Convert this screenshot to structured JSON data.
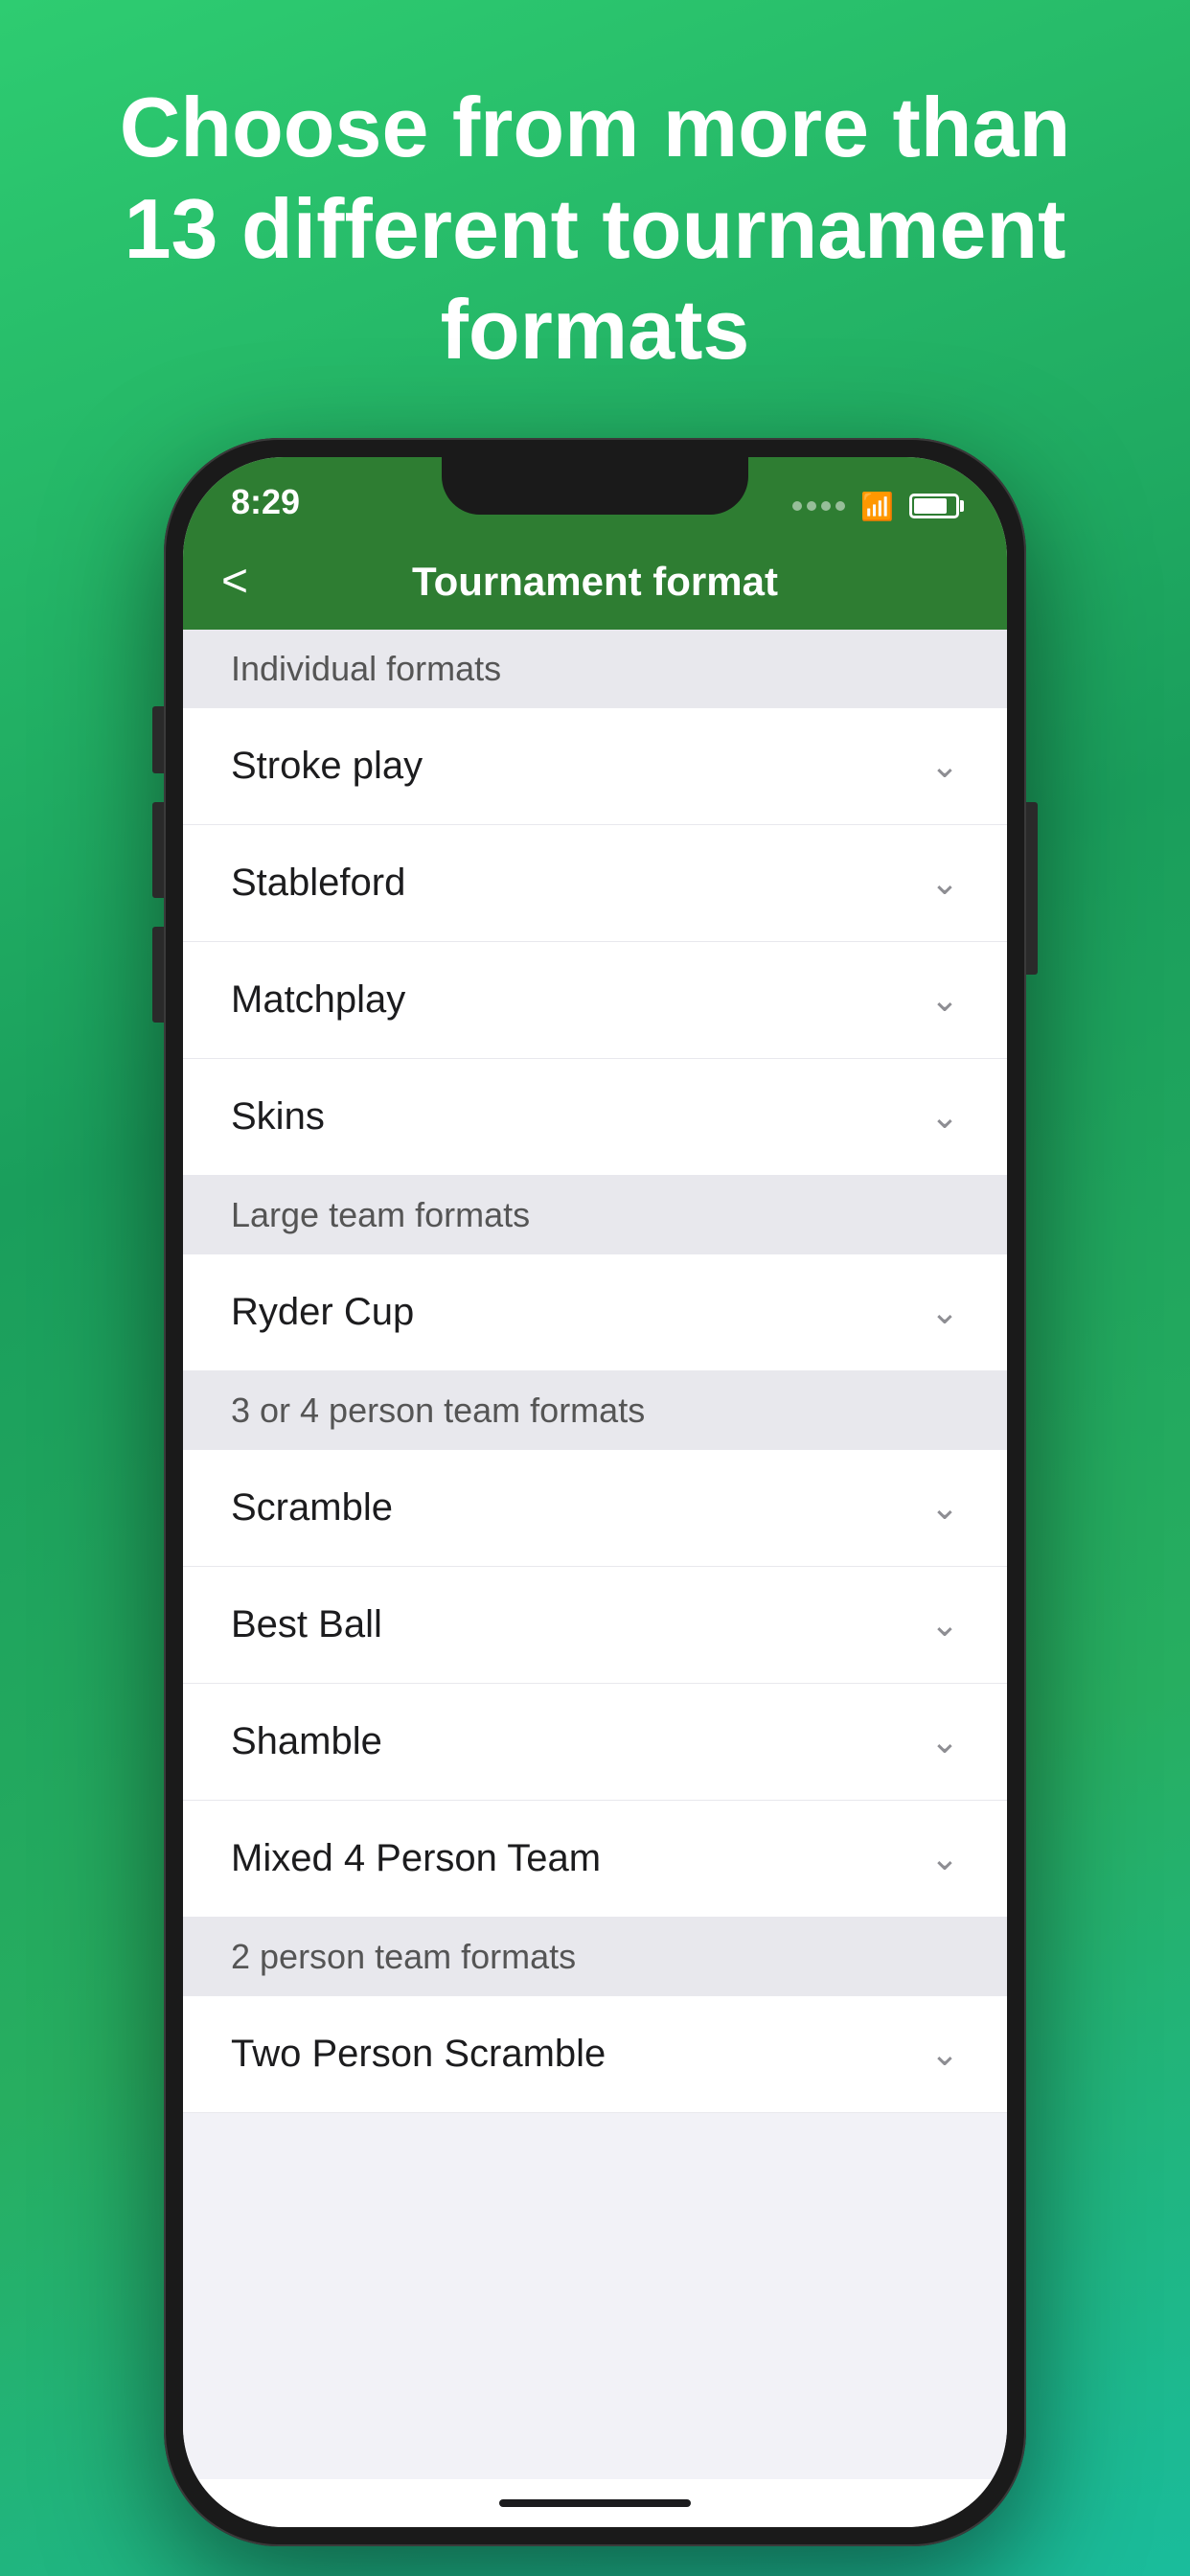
{
  "background": {
    "gradient_start": "#2ecc71",
    "gradient_end": "#1abc9c"
  },
  "headline": {
    "text": "Choose from more than 13 different tournament formats"
  },
  "status_bar": {
    "time": "8:29",
    "accent_color": "#2e7d32"
  },
  "nav": {
    "back_label": "<",
    "title": "Tournament format"
  },
  "sections": [
    {
      "id": "individual",
      "header": "Individual formats",
      "items": [
        {
          "id": "stroke-play",
          "label": "Stroke play"
        },
        {
          "id": "stableford",
          "label": "Stableford"
        },
        {
          "id": "matchplay",
          "label": "Matchplay"
        },
        {
          "id": "skins",
          "label": "Skins"
        }
      ]
    },
    {
      "id": "large-team",
      "header": "Large team formats",
      "items": [
        {
          "id": "ryder-cup",
          "label": "Ryder Cup"
        }
      ]
    },
    {
      "id": "3-or-4-person",
      "header": "3 or 4 person team formats",
      "items": [
        {
          "id": "scramble",
          "label": "Scramble"
        },
        {
          "id": "best-ball",
          "label": "Best Ball"
        },
        {
          "id": "shamble",
          "label": "Shamble"
        },
        {
          "id": "mixed-4-person-team",
          "label": "Mixed 4 Person Team"
        }
      ]
    },
    {
      "id": "2-person",
      "header": "2 person team formats",
      "items": [
        {
          "id": "two-person-scramble",
          "label": "Two Person Scramble"
        }
      ]
    }
  ],
  "chevron": "❯",
  "home_bar": true
}
